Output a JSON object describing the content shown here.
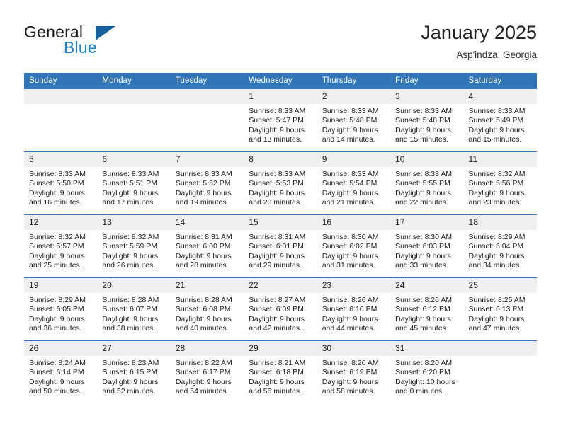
{
  "brand": {
    "word_one": "General",
    "word_two": "Blue",
    "triangle_icon": "triangle-icon"
  },
  "header": {
    "title": "January 2025",
    "subtitle": "Asp'indza, Georgia"
  },
  "theme": {
    "header_blue": "#3075b8",
    "daynum_band": "#efefef",
    "text": "#1c1c1c",
    "brand_blue": "#1f7fc4",
    "brand_triangle": "#15619e"
  },
  "weekday_headers": [
    "Sunday",
    "Monday",
    "Tuesday",
    "Wednesday",
    "Thursday",
    "Friday",
    "Saturday"
  ],
  "weeks": [
    [
      {
        "day": "",
        "lines": []
      },
      {
        "day": "",
        "lines": []
      },
      {
        "day": "",
        "lines": []
      },
      {
        "day": "1",
        "lines": [
          "Sunrise: 8:33 AM",
          "Sunset: 5:47 PM",
          "Daylight: 9 hours",
          "and 13 minutes."
        ]
      },
      {
        "day": "2",
        "lines": [
          "Sunrise: 8:33 AM",
          "Sunset: 5:48 PM",
          "Daylight: 9 hours",
          "and 14 minutes."
        ]
      },
      {
        "day": "3",
        "lines": [
          "Sunrise: 8:33 AM",
          "Sunset: 5:48 PM",
          "Daylight: 9 hours",
          "and 15 minutes."
        ]
      },
      {
        "day": "4",
        "lines": [
          "Sunrise: 8:33 AM",
          "Sunset: 5:49 PM",
          "Daylight: 9 hours",
          "and 15 minutes."
        ]
      }
    ],
    [
      {
        "day": "5",
        "lines": [
          "Sunrise: 8:33 AM",
          "Sunset: 5:50 PM",
          "Daylight: 9 hours",
          "and 16 minutes."
        ]
      },
      {
        "day": "6",
        "lines": [
          "Sunrise: 8:33 AM",
          "Sunset: 5:51 PM",
          "Daylight: 9 hours",
          "and 17 minutes."
        ]
      },
      {
        "day": "7",
        "lines": [
          "Sunrise: 8:33 AM",
          "Sunset: 5:52 PM",
          "Daylight: 9 hours",
          "and 19 minutes."
        ]
      },
      {
        "day": "8",
        "lines": [
          "Sunrise: 8:33 AM",
          "Sunset: 5:53 PM",
          "Daylight: 9 hours",
          "and 20 minutes."
        ]
      },
      {
        "day": "9",
        "lines": [
          "Sunrise: 8:33 AM",
          "Sunset: 5:54 PM",
          "Daylight: 9 hours",
          "and 21 minutes."
        ]
      },
      {
        "day": "10",
        "lines": [
          "Sunrise: 8:33 AM",
          "Sunset: 5:55 PM",
          "Daylight: 9 hours",
          "and 22 minutes."
        ]
      },
      {
        "day": "11",
        "lines": [
          "Sunrise: 8:32 AM",
          "Sunset: 5:56 PM",
          "Daylight: 9 hours",
          "and 23 minutes."
        ]
      }
    ],
    [
      {
        "day": "12",
        "lines": [
          "Sunrise: 8:32 AM",
          "Sunset: 5:57 PM",
          "Daylight: 9 hours",
          "and 25 minutes."
        ]
      },
      {
        "day": "13",
        "lines": [
          "Sunrise: 8:32 AM",
          "Sunset: 5:59 PM",
          "Daylight: 9 hours",
          "and 26 minutes."
        ]
      },
      {
        "day": "14",
        "lines": [
          "Sunrise: 8:31 AM",
          "Sunset: 6:00 PM",
          "Daylight: 9 hours",
          "and 28 minutes."
        ]
      },
      {
        "day": "15",
        "lines": [
          "Sunrise: 8:31 AM",
          "Sunset: 6:01 PM",
          "Daylight: 9 hours",
          "and 29 minutes."
        ]
      },
      {
        "day": "16",
        "lines": [
          "Sunrise: 8:30 AM",
          "Sunset: 6:02 PM",
          "Daylight: 9 hours",
          "and 31 minutes."
        ]
      },
      {
        "day": "17",
        "lines": [
          "Sunrise: 8:30 AM",
          "Sunset: 6:03 PM",
          "Daylight: 9 hours",
          "and 33 minutes."
        ]
      },
      {
        "day": "18",
        "lines": [
          "Sunrise: 8:29 AM",
          "Sunset: 6:04 PM",
          "Daylight: 9 hours",
          "and 34 minutes."
        ]
      }
    ],
    [
      {
        "day": "19",
        "lines": [
          "Sunrise: 8:29 AM",
          "Sunset: 6:05 PM",
          "Daylight: 9 hours",
          "and 36 minutes."
        ]
      },
      {
        "day": "20",
        "lines": [
          "Sunrise: 8:28 AM",
          "Sunset: 6:07 PM",
          "Daylight: 9 hours",
          "and 38 minutes."
        ]
      },
      {
        "day": "21",
        "lines": [
          "Sunrise: 8:28 AM",
          "Sunset: 6:08 PM",
          "Daylight: 9 hours",
          "and 40 minutes."
        ]
      },
      {
        "day": "22",
        "lines": [
          "Sunrise: 8:27 AM",
          "Sunset: 6:09 PM",
          "Daylight: 9 hours",
          "and 42 minutes."
        ]
      },
      {
        "day": "23",
        "lines": [
          "Sunrise: 8:26 AM",
          "Sunset: 6:10 PM",
          "Daylight: 9 hours",
          "and 44 minutes."
        ]
      },
      {
        "day": "24",
        "lines": [
          "Sunrise: 8:26 AM",
          "Sunset: 6:12 PM",
          "Daylight: 9 hours",
          "and 45 minutes."
        ]
      },
      {
        "day": "25",
        "lines": [
          "Sunrise: 8:25 AM",
          "Sunset: 6:13 PM",
          "Daylight: 9 hours",
          "and 47 minutes."
        ]
      }
    ],
    [
      {
        "day": "26",
        "lines": [
          "Sunrise: 8:24 AM",
          "Sunset: 6:14 PM",
          "Daylight: 9 hours",
          "and 50 minutes."
        ]
      },
      {
        "day": "27",
        "lines": [
          "Sunrise: 8:23 AM",
          "Sunset: 6:15 PM",
          "Daylight: 9 hours",
          "and 52 minutes."
        ]
      },
      {
        "day": "28",
        "lines": [
          "Sunrise: 8:22 AM",
          "Sunset: 6:17 PM",
          "Daylight: 9 hours",
          "and 54 minutes."
        ]
      },
      {
        "day": "29",
        "lines": [
          "Sunrise: 8:21 AM",
          "Sunset: 6:18 PM",
          "Daylight: 9 hours",
          "and 56 minutes."
        ]
      },
      {
        "day": "30",
        "lines": [
          "Sunrise: 8:20 AM",
          "Sunset: 6:19 PM",
          "Daylight: 9 hours",
          "and 58 minutes."
        ]
      },
      {
        "day": "31",
        "lines": [
          "Sunrise: 8:20 AM",
          "Sunset: 6:20 PM",
          "Daylight: 10 hours",
          "and 0 minutes."
        ]
      },
      {
        "day": "",
        "lines": []
      }
    ]
  ]
}
